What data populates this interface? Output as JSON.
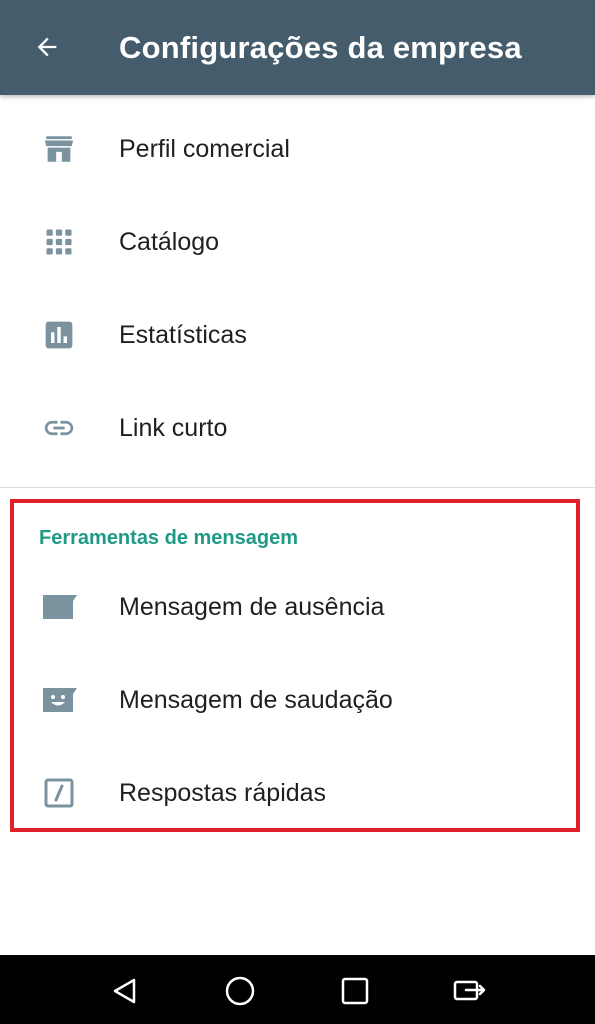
{
  "appbar": {
    "title": "Configurações da empresa",
    "back_icon": "arrow-left-icon",
    "background": "#445c6b"
  },
  "items": [
    {
      "label": "Perfil comercial",
      "icon": "storefront-icon"
    },
    {
      "label": "Catálogo",
      "icon": "grid-dots-icon"
    },
    {
      "label": "Estatísticas",
      "icon": "bar-chart-icon"
    },
    {
      "label": "Link curto",
      "icon": "link-icon"
    }
  ],
  "message_tools": {
    "header": "Ferramentas de mensagem",
    "header_color": "#1e9a86",
    "items": [
      {
        "label": "Mensagem de ausência",
        "icon": "away-message-icon"
      },
      {
        "label": "Mensagem de saudação",
        "icon": "greeting-message-icon"
      },
      {
        "label": "Respostas rápidas",
        "icon": "quick-reply-icon"
      }
    ]
  },
  "highlight_color": "#e2202a",
  "icon_color": "#7b929f",
  "navbar": {
    "buttons": [
      "back-triangle-icon",
      "home-circle-icon",
      "recents-square-icon",
      "screen-switch-icon"
    ]
  }
}
